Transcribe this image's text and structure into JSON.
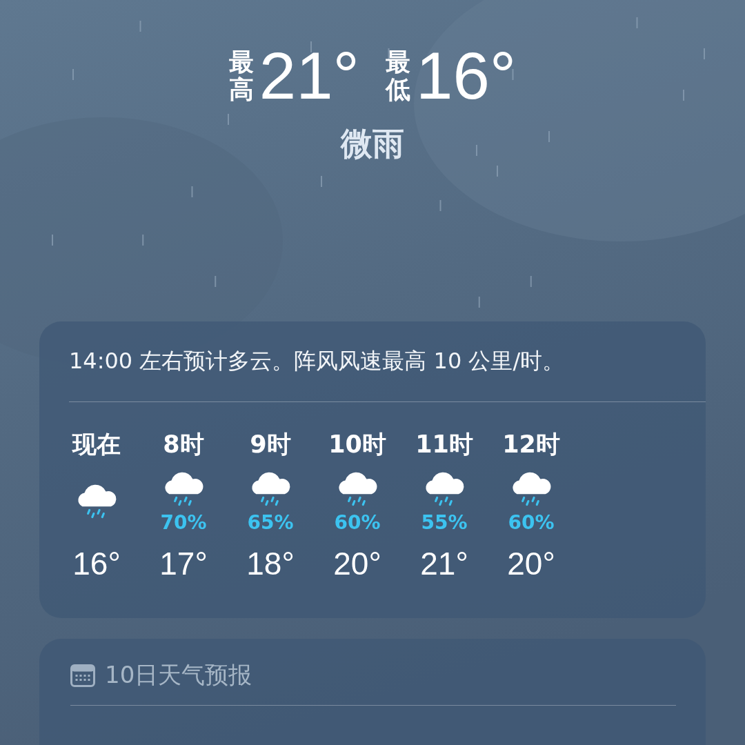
{
  "today": {
    "high_label": "最高",
    "high": "21°",
    "low_label": "最低",
    "low": "16°",
    "condition": "微雨"
  },
  "hourly": {
    "summary": "14:00 左右预计多云。阵风风速最高 10 公里/时。",
    "hours": [
      {
        "time": "现在",
        "kind": "rain",
        "temp": "16°"
      },
      {
        "time": "8时",
        "kind": "rain",
        "precipitation": "70%",
        "temp": "17°"
      },
      {
        "time": "9时",
        "kind": "rain",
        "precipitation": "65%",
        "temp": "18°"
      },
      {
        "time": "10时",
        "kind": "rain",
        "precipitation": "60%",
        "temp": "20°"
      },
      {
        "time": "11时",
        "kind": "rain",
        "precipitation": "55%",
        "temp": "21°"
      },
      {
        "time": "12时",
        "kind": "rain",
        "precipitation": "60%",
        "temp": "20°"
      }
    ]
  },
  "forecast": {
    "title": "10日天气预报"
  }
}
